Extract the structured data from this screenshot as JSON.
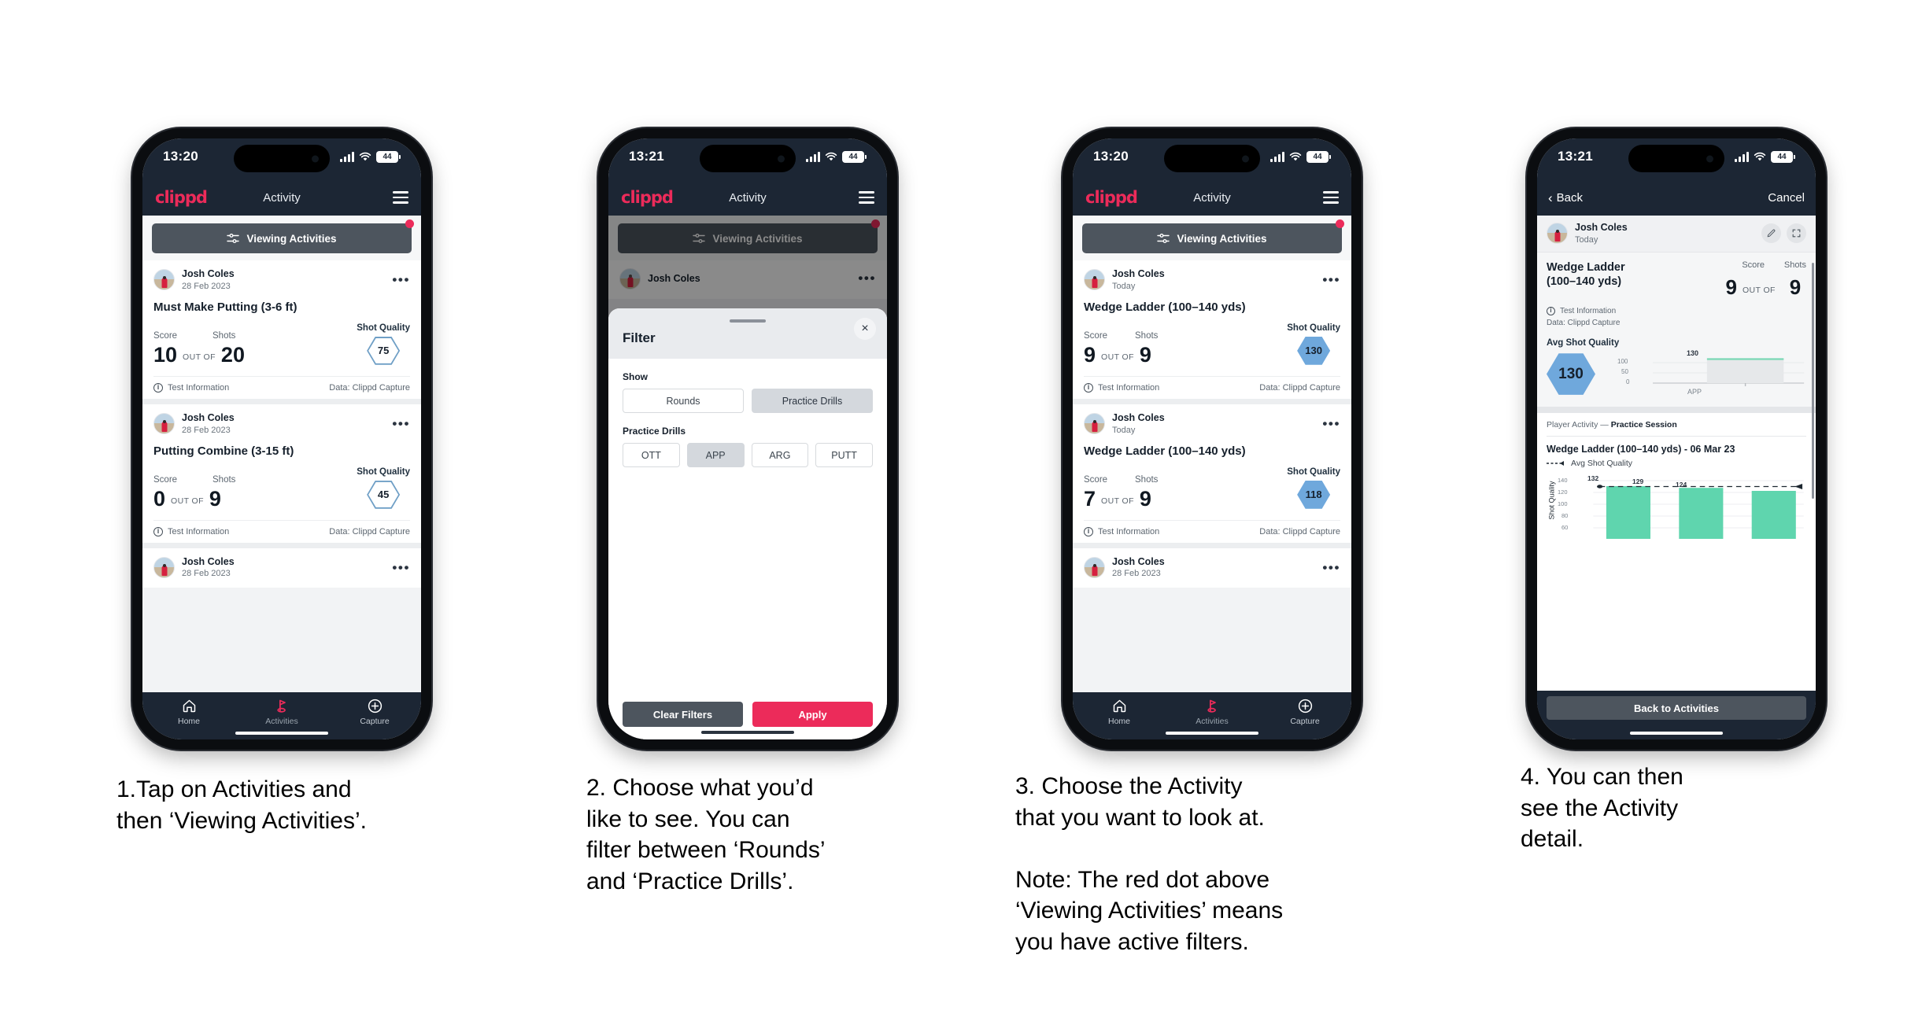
{
  "phones": [
    {
      "id": "phone-1",
      "status": {
        "time": "13:20",
        "battery": "44"
      },
      "appbar": {
        "logo": "clippd",
        "title": "Activity",
        "menu": "menu-icon"
      },
      "filter_bar": {
        "label": "Viewing Activities",
        "has_badge": true
      },
      "cards": [
        {
          "user": "Josh Coles",
          "date": "28 Feb 2023",
          "title": "Must Make Putting (3-6 ft)",
          "score_label": "Score",
          "shots_label": "Shots",
          "quality_label": "Shot Quality",
          "score": "10",
          "out_of": "OUT OF",
          "shots": "20",
          "quality": "75",
          "quality_style": "outline",
          "foot_left": "Test Information",
          "foot_right": "Data: Clippd Capture"
        },
        {
          "user": "Josh Coles",
          "date": "28 Feb 2023",
          "title": "Putting Combine (3-15 ft)",
          "score_label": "Score",
          "shots_label": "Shots",
          "quality_label": "Shot Quality",
          "score": "0",
          "out_of": "OUT OF",
          "shots": "9",
          "quality": "45",
          "quality_style": "outline",
          "foot_left": "Test Information",
          "foot_right": "Data: Clippd Capture"
        },
        {
          "user": "Josh Coles",
          "date": "28 Feb 2023",
          "partial": true
        }
      ],
      "tabs": [
        {
          "label": "Home",
          "icon": "home-icon",
          "active": false
        },
        {
          "label": "Activities",
          "icon": "golf-flag-icon",
          "active": true
        },
        {
          "label": "Capture",
          "icon": "plus-circle-icon",
          "active": false
        }
      ]
    },
    {
      "id": "phone-2",
      "status": {
        "time": "13:21",
        "battery": "44"
      },
      "appbar": {
        "logo": "clippd",
        "title": "Activity",
        "menu": "menu-icon"
      },
      "filter_bar": {
        "label": "Viewing Activities",
        "has_badge": true
      },
      "behind_card": {
        "user": "Josh Coles"
      },
      "modal": {
        "title": "Filter",
        "close": "×",
        "show_label": "Show",
        "show_options": [
          {
            "label": "Rounds",
            "selected": false
          },
          {
            "label": "Practice Drills",
            "selected": true
          }
        ],
        "drills_label": "Practice Drills",
        "drill_options": [
          {
            "label": "OTT",
            "selected": false
          },
          {
            "label": "APP",
            "selected": true
          },
          {
            "label": "ARG",
            "selected": false
          },
          {
            "label": "PUTT",
            "selected": false
          }
        ],
        "clear_label": "Clear Filters",
        "apply_label": "Apply"
      }
    },
    {
      "id": "phone-3",
      "status": {
        "time": "13:20",
        "battery": "44"
      },
      "appbar": {
        "logo": "clippd",
        "title": "Activity",
        "menu": "menu-icon"
      },
      "filter_bar": {
        "label": "Viewing Activities",
        "has_badge": true
      },
      "cards": [
        {
          "user": "Josh Coles",
          "date": "Today",
          "title": "Wedge Ladder (100–140 yds)",
          "score_label": "Score",
          "shots_label": "Shots",
          "quality_label": "Shot Quality",
          "score": "9",
          "out_of": "OUT OF",
          "shots": "9",
          "quality": "130",
          "quality_style": "filled",
          "foot_left": "Test Information",
          "foot_right": "Data: Clippd Capture"
        },
        {
          "user": "Josh Coles",
          "date": "Today",
          "title": "Wedge Ladder (100–140 yds)",
          "score_label": "Score",
          "shots_label": "Shots",
          "quality_label": "Shot Quality",
          "score": "7",
          "out_of": "OUT OF",
          "shots": "9",
          "quality": "118",
          "quality_style": "filled",
          "foot_left": "Test Information",
          "foot_right": "Data: Clippd Capture"
        },
        {
          "user": "Josh Coles",
          "date": "28 Feb 2023",
          "partial": true
        }
      ],
      "tabs": [
        {
          "label": "Home",
          "icon": "home-icon",
          "active": false
        },
        {
          "label": "Activities",
          "icon": "golf-flag-icon",
          "active": true
        },
        {
          "label": "Capture",
          "icon": "plus-circle-icon",
          "active": false
        }
      ]
    },
    {
      "id": "phone-4",
      "status": {
        "time": "13:21",
        "battery": "44"
      },
      "navbar": {
        "back": "Back",
        "cancel": "Cancel"
      },
      "user": {
        "name": "Josh Coles",
        "date": "Today",
        "edit_icon": "pencil-icon",
        "expand_icon": "expand-icon"
      },
      "detail": {
        "title": "Wedge Ladder\n(100–140 yds)",
        "score_label": "Score",
        "shots_label": "Shots",
        "score": "9",
        "out_of": "OUT OF",
        "shots": "9",
        "foot_left": "Test Information",
        "foot_right": "Data: Clippd Capture",
        "avg_label": "Avg Shot Quality",
        "avg_value": "130",
        "section_prefix": "Player Activity — ",
        "section_bold": "Practice Session",
        "chart_title": "Wedge Ladder (100–140 yds) - 06 Mar 23",
        "legend": "Avg Shot Quality",
        "back_button": "Back to Activities"
      }
    }
  ],
  "captions": [
    {
      "text": "1.Tap on Activities and\nthen ‘Viewing Activities’."
    },
    {
      "text": "2. Choose what you’d\nlike to see. You can\nfilter between ‘Rounds’\nand ‘Practice Drills’."
    },
    {
      "text": "3. Choose the Activity\nthat you want to look at.\n\nNote: The red dot above\n‘Viewing Activities’ means\nyou have active filters."
    },
    {
      "text": "4. You can then\nsee the Activity\ndetail."
    }
  ],
  "chart_data": [
    {
      "type": "bar",
      "id": "mini-app-chart",
      "categories": [
        "APP"
      ],
      "values": [
        130
      ],
      "labels": [
        "130"
      ],
      "ylabel": "",
      "yticks": [
        0,
        50,
        100
      ],
      "ylim": [
        0,
        150
      ],
      "grid": true,
      "title": "",
      "bar_color": "#e4e6e8",
      "cap_color": "#7ad7b5"
    },
    {
      "type": "bar",
      "id": "shot-quality-chart",
      "categories": [
        "1",
        "2",
        "3"
      ],
      "values": [
        132,
        129,
        124
      ],
      "labels": [
        "132",
        "129",
        "124"
      ],
      "ylabel": "Shot Quality",
      "yticks": [
        60,
        80,
        100,
        120,
        140
      ],
      "ylim": [
        50,
        145
      ],
      "grid": true,
      "title": "Wedge Ladder (100–140 yds) - 06 Mar 23",
      "legend": [
        "Avg Shot Quality"
      ],
      "legend_position": "top-left",
      "bar_color": "#5fd5ae",
      "avg_line": 130
    }
  ],
  "colors": {
    "brand_pink": "#ec2b5a",
    "header_navy": "#1c2634",
    "slate": "#4d555e",
    "hex_blue": "#6fa8dc",
    "bar_green": "#5fd5ae"
  }
}
